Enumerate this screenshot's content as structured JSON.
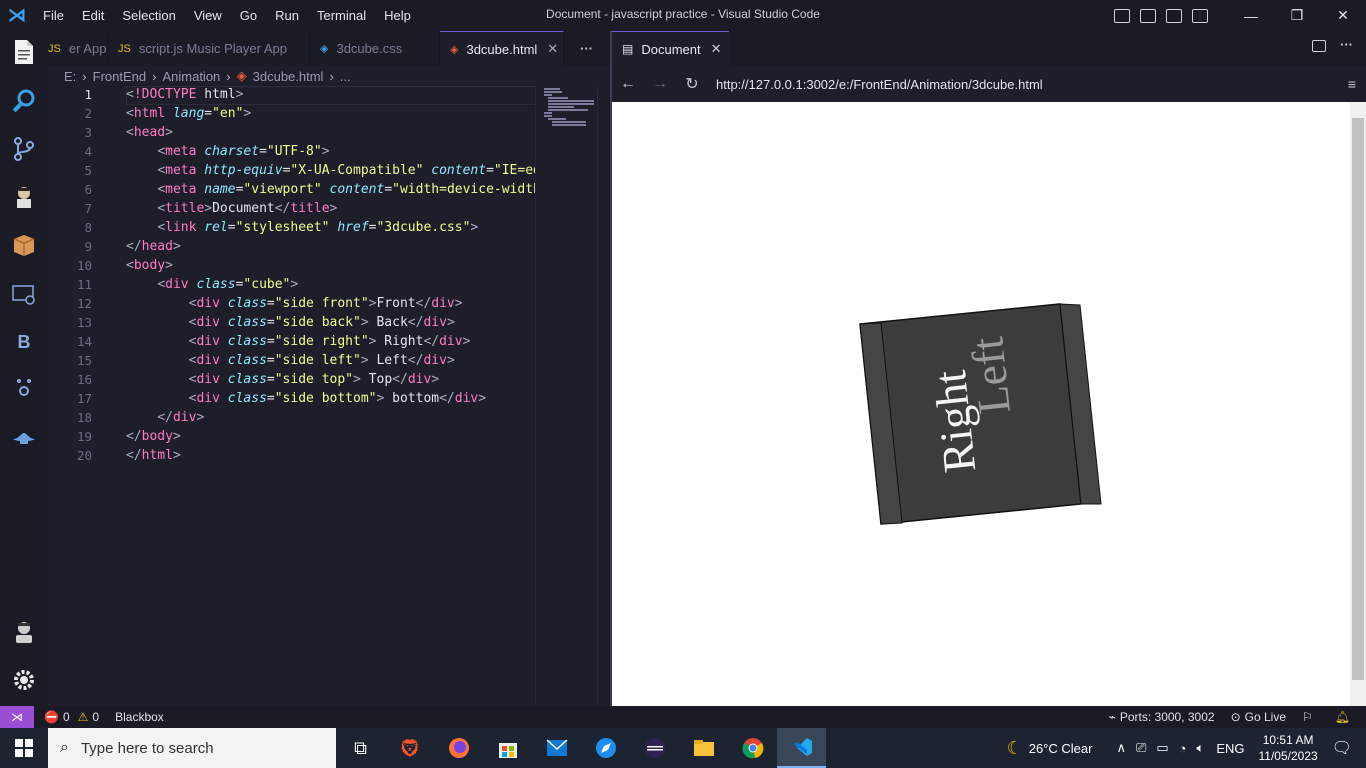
{
  "window": {
    "title": "Document - javascript practice - Visual Studio Code",
    "menu": [
      "File",
      "Edit",
      "Selection",
      "View",
      "Go",
      "Run",
      "Terminal",
      "Help"
    ],
    "controls": {
      "minimize": "—",
      "restore": "❐",
      "close": "✕"
    }
  },
  "editor": {
    "tabs": [
      {
        "label": "er App",
        "icon": "js-icon",
        "active": false
      },
      {
        "label": "script.js  Music Player App",
        "icon": "js-icon",
        "active": false
      },
      {
        "label": "3dcube.css",
        "icon": "css-icon",
        "active": false
      },
      {
        "label": "3dcube.html",
        "icon": "html-icon",
        "active": true
      }
    ],
    "more": "···",
    "breadcrumb": [
      "E:",
      "FrontEnd",
      "Animation",
      "3dcube.html",
      "..."
    ],
    "current_line": 1,
    "lines": [
      "<!DOCTYPE html>",
      "<html lang=\"en\">",
      "<head>",
      "    <meta charset=\"UTF-8\">",
      "    <meta http-equiv=\"X-UA-Compatible\" content=\"IE=ed",
      "    <meta name=\"viewport\" content=\"width=device-width",
      "    <title>Document</title>",
      "    <link rel=\"stylesheet\" href=\"3dcube.css\">",
      "</head>",
      "<body>",
      "    <div class=\"cube\">",
      "        <div class=\"side front\">Front</div>",
      "        <div class=\"side back\"> Back</div>",
      "        <div class=\"side right\"> Right</div>",
      "        <div class=\"side left\"> Left</div>",
      "        <div class=\"side top\"> Top</div>",
      "        <div class=\"side bottom\"> bottom</div>",
      "    </div>",
      "</body>",
      "</html>"
    ]
  },
  "preview": {
    "tab_label": "Document",
    "url": "http://127.0.0.1:3002/e:/FrontEnd/Animation/3dcube.html",
    "cube_face_text": "Right",
    "cube_ghost_text": "Left"
  },
  "statusbar": {
    "errors": "0",
    "warnings": "0",
    "extension": "Blackbox",
    "ports": "Ports: 3000, 3002",
    "golive": "Go Live"
  },
  "taskbar": {
    "search_placeholder": "Type here to search",
    "weather": "26°C  Clear",
    "lang": "ENG",
    "time": "10:51 AM",
    "date": "11/05/2023"
  }
}
